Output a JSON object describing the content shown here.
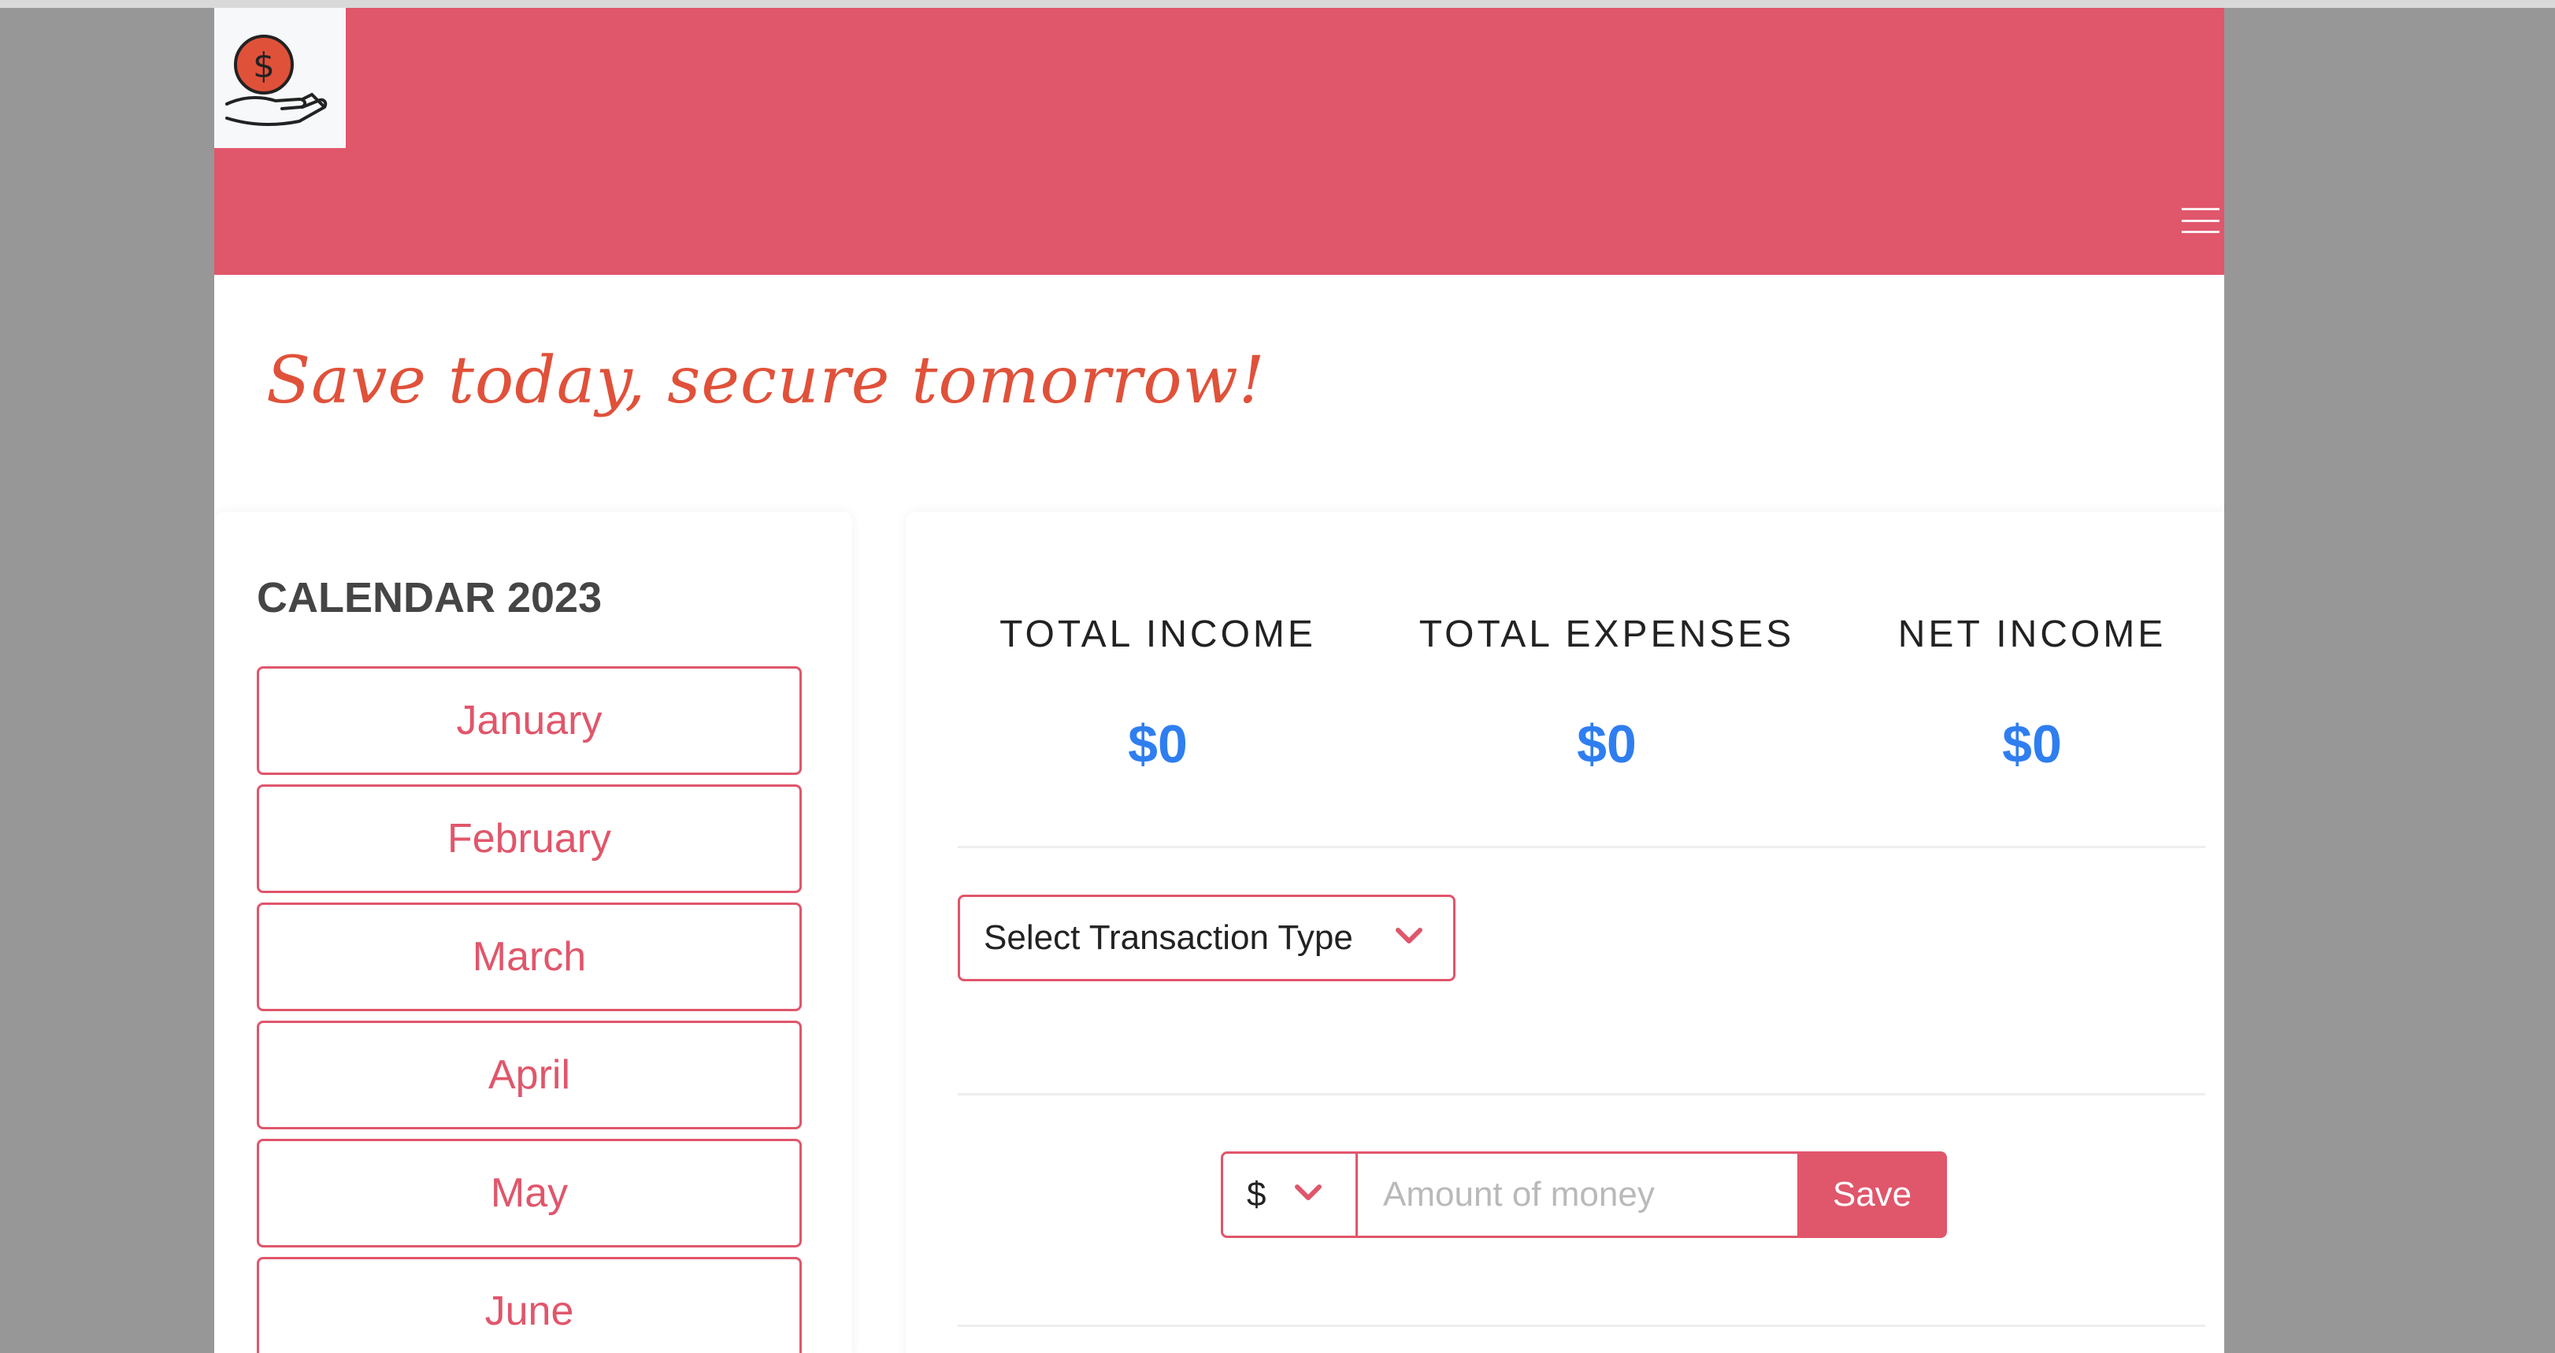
{
  "header": {
    "logo_icon": "dollar-hand-icon",
    "menu_icon": "hamburger-icon",
    "brand_color": "#e0566b"
  },
  "tagline": "Save today, secure tomorrow!",
  "calendar": {
    "title": "CALENDAR 2023",
    "months": [
      "January",
      "February",
      "March",
      "April",
      "May",
      "June"
    ]
  },
  "summary": {
    "stats": [
      {
        "label": "TOTAL INCOME",
        "value": "$0"
      },
      {
        "label": "TOTAL EXPENSES",
        "value": "$0"
      },
      {
        "label": "NET INCOME",
        "value": "$0"
      }
    ],
    "value_color": "#2f7ef0"
  },
  "transaction": {
    "type_selected": "Select Transaction Type",
    "currency_selected": "$",
    "amount_placeholder": "Amount of money",
    "amount_value": "",
    "save_label": "Save"
  }
}
